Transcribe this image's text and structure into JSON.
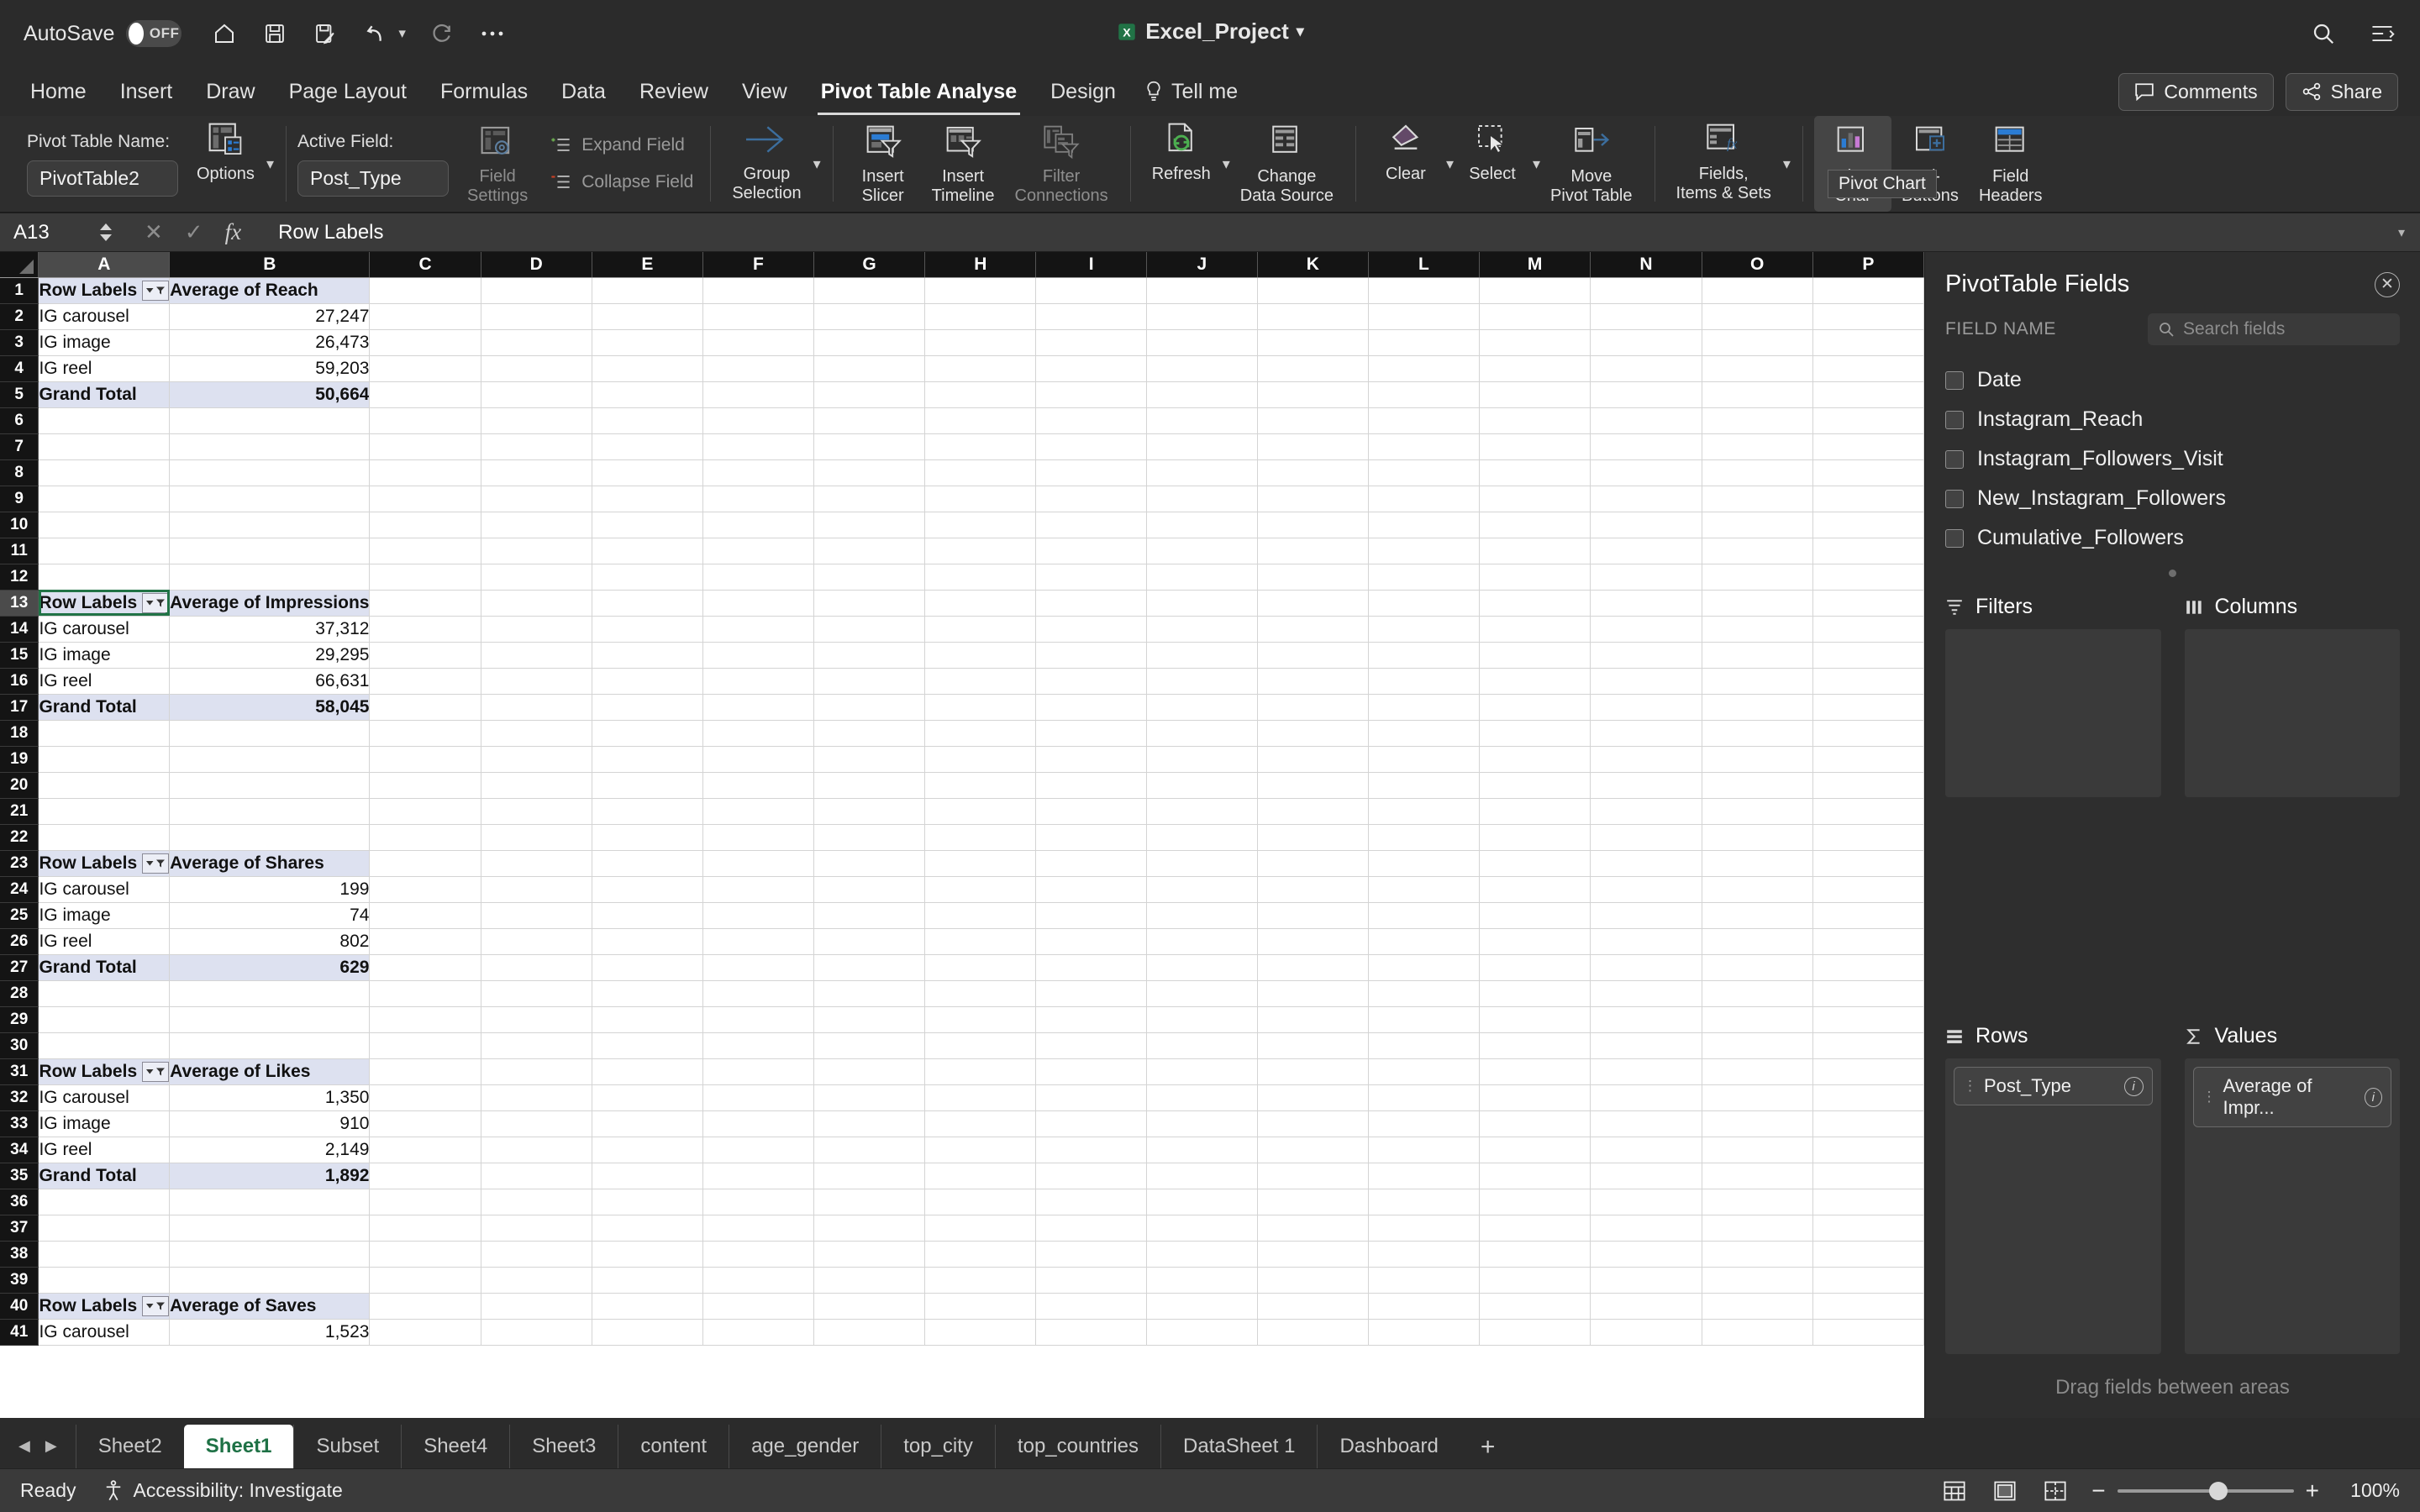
{
  "titlebar": {
    "autosave_label": "AutoSave",
    "autosave_state": "OFF",
    "doc_title": "Excel_Project",
    "icons": [
      "home-icon",
      "save-icon",
      "save-as-icon",
      "undo-icon",
      "redo-icon",
      "more-icon"
    ],
    "right_icons": [
      "search-icon",
      "ribbon-display-icon"
    ]
  },
  "ribbon_tabs": {
    "tabs": [
      {
        "label": "Home",
        "active": false
      },
      {
        "label": "Insert",
        "active": false
      },
      {
        "label": "Draw",
        "active": false
      },
      {
        "label": "Page Layout",
        "active": false
      },
      {
        "label": "Formulas",
        "active": false
      },
      {
        "label": "Data",
        "active": false
      },
      {
        "label": "Review",
        "active": false
      },
      {
        "label": "View",
        "active": false
      },
      {
        "label": "Pivot Table Analyse",
        "active": true
      },
      {
        "label": "Design",
        "active": false
      }
    ],
    "tell_me": "Tell me",
    "comments": "Comments",
    "share": "Share"
  },
  "ribbon": {
    "pivot_table_name_label": "Pivot Table Name:",
    "pivot_table_name_value": "PivotTable2",
    "options_label": "Options",
    "active_field_label": "Active Field:",
    "active_field_value": "Post_Type",
    "field_settings_label": "Field\nSettings",
    "expand_field_label": "Expand Field",
    "collapse_field_label": "Collapse Field",
    "group_selection_label": "Group\nSelection",
    "insert_slicer_label": "Insert\nSlicer",
    "insert_timeline_label": "Insert\nTimeline",
    "filter_connections_label": "Filter\nConnections",
    "refresh_label": "Refresh",
    "change_data_source_label": "Change\nData Source",
    "clear_label": "Clear",
    "select_label": "Select",
    "move_pivot_table_label": "Move\nPivot Table",
    "fields_items_sets_label": "Fields,\nItems & Sets",
    "pivot_chart_tooltip_partial": "Pivo\nChar",
    "pivot_chart_tooltip": "Pivot Chart",
    "plusminus_buttons_label": "+/-\nButtons",
    "field_headers_label": "Field\nHeaders"
  },
  "formula_bar": {
    "cell_ref": "A13",
    "formula": "Row Labels",
    "cancel_icon": "close-icon",
    "enter_icon": "check-icon",
    "fx_icon": "fx-icon"
  },
  "grid": {
    "columns": [
      "A",
      "B",
      "C",
      "D",
      "E",
      "F",
      "G",
      "H",
      "I",
      "J",
      "K",
      "L",
      "M",
      "N",
      "O",
      "P"
    ],
    "selected_column": "A",
    "selected_row": 13,
    "rows": [
      {
        "n": 1,
        "a": "Row Labels",
        "b": "Average of Reach",
        "style": "header",
        "filter": true
      },
      {
        "n": 2,
        "a": "IG carousel",
        "b": "27,247",
        "style": "data"
      },
      {
        "n": 3,
        "a": "IG image",
        "b": "26,473",
        "style": "data"
      },
      {
        "n": 4,
        "a": "IG reel",
        "b": "59,203",
        "style": "data"
      },
      {
        "n": 5,
        "a": "Grand Total",
        "b": "50,664",
        "style": "total"
      },
      {
        "n": 6,
        "a": "",
        "b": "",
        "style": "empty"
      },
      {
        "n": 7,
        "a": "",
        "b": "",
        "style": "empty"
      },
      {
        "n": 8,
        "a": "",
        "b": "",
        "style": "empty"
      },
      {
        "n": 9,
        "a": "",
        "b": "",
        "style": "empty"
      },
      {
        "n": 10,
        "a": "",
        "b": "",
        "style": "empty"
      },
      {
        "n": 11,
        "a": "",
        "b": "",
        "style": "empty"
      },
      {
        "n": 12,
        "a": "",
        "b": "",
        "style": "empty"
      },
      {
        "n": 13,
        "a": "Row Labels",
        "b": "Average of Impressions",
        "style": "header",
        "filter": true,
        "selected": true
      },
      {
        "n": 14,
        "a": "IG carousel",
        "b": "37,312",
        "style": "data"
      },
      {
        "n": 15,
        "a": "IG image",
        "b": "29,295",
        "style": "data"
      },
      {
        "n": 16,
        "a": "IG reel",
        "b": "66,631",
        "style": "data"
      },
      {
        "n": 17,
        "a": "Grand Total",
        "b": "58,045",
        "style": "total"
      },
      {
        "n": 18,
        "a": "",
        "b": "",
        "style": "empty"
      },
      {
        "n": 19,
        "a": "",
        "b": "",
        "style": "empty"
      },
      {
        "n": 20,
        "a": "",
        "b": "",
        "style": "empty"
      },
      {
        "n": 21,
        "a": "",
        "b": "",
        "style": "empty"
      },
      {
        "n": 22,
        "a": "",
        "b": "",
        "style": "empty"
      },
      {
        "n": 23,
        "a": "Row Labels",
        "b": "Average of Shares",
        "style": "header",
        "filter": true
      },
      {
        "n": 24,
        "a": "IG carousel",
        "b": "199",
        "style": "data"
      },
      {
        "n": 25,
        "a": "IG image",
        "b": "74",
        "style": "data"
      },
      {
        "n": 26,
        "a": "IG reel",
        "b": "802",
        "style": "data"
      },
      {
        "n": 27,
        "a": "Grand Total",
        "b": "629",
        "style": "total"
      },
      {
        "n": 28,
        "a": "",
        "b": "",
        "style": "empty"
      },
      {
        "n": 29,
        "a": "",
        "b": "",
        "style": "empty"
      },
      {
        "n": 30,
        "a": "",
        "b": "",
        "style": "empty"
      },
      {
        "n": 31,
        "a": "Row Labels",
        "b": "Average of Likes",
        "style": "header",
        "filter": true
      },
      {
        "n": 32,
        "a": "IG carousel",
        "b": "1,350",
        "style": "data"
      },
      {
        "n": 33,
        "a": "IG image",
        "b": "910",
        "style": "data"
      },
      {
        "n": 34,
        "a": "IG reel",
        "b": "2,149",
        "style": "data"
      },
      {
        "n": 35,
        "a": "Grand Total",
        "b": "1,892",
        "style": "total"
      },
      {
        "n": 36,
        "a": "",
        "b": "",
        "style": "empty"
      },
      {
        "n": 37,
        "a": "",
        "b": "",
        "style": "empty"
      },
      {
        "n": 38,
        "a": "",
        "b": "",
        "style": "empty"
      },
      {
        "n": 39,
        "a": "",
        "b": "",
        "style": "empty"
      },
      {
        "n": 40,
        "a": "Row Labels",
        "b": "Average of Saves",
        "style": "header",
        "filter": true
      },
      {
        "n": 41,
        "a": "IG carousel",
        "b": "1,523",
        "style": "data"
      }
    ]
  },
  "fields_pane": {
    "title": "PivotTable Fields",
    "field_name_label": "FIELD NAME",
    "search_placeholder": "Search fields",
    "fields": [
      {
        "label": "Date",
        "checked": false
      },
      {
        "label": "Instagram_Reach",
        "checked": false
      },
      {
        "label": "Instagram_Followers_Visit",
        "checked": false
      },
      {
        "label": "New_Instagram_Followers",
        "checked": false
      },
      {
        "label": "Cumulative_Followers",
        "checked": false
      }
    ],
    "areas": {
      "filters": {
        "label": "Filters",
        "items": []
      },
      "columns": {
        "label": "Columns",
        "items": []
      },
      "rows": {
        "label": "Rows",
        "items": [
          {
            "label": "Post_Type"
          }
        ]
      },
      "values": {
        "label": "Values",
        "items": [
          {
            "label": "Average of Impr..."
          }
        ]
      }
    },
    "drag_hint": "Drag fields between areas"
  },
  "sheet_tabs": {
    "tabs": [
      {
        "label": "Sheet2",
        "active": false
      },
      {
        "label": "Sheet1",
        "active": true
      },
      {
        "label": "Subset",
        "active": false
      },
      {
        "label": "Sheet4",
        "active": false
      },
      {
        "label": "Sheet3",
        "active": false
      },
      {
        "label": "content",
        "active": false
      },
      {
        "label": "age_gender",
        "active": false
      },
      {
        "label": "top_city",
        "active": false
      },
      {
        "label": "top_countries",
        "active": false
      },
      {
        "label": "DataSheet 1",
        "active": false
      },
      {
        "label": "Dashboard",
        "active": false
      }
    ],
    "add_label": "+"
  },
  "status_bar": {
    "ready": "Ready",
    "accessibility": "Accessibility: Investigate",
    "zoom": "100%",
    "views": [
      "normal-view-icon",
      "page-layout-view-icon",
      "page-break-view-icon"
    ]
  },
  "colors": {
    "accent_green": "#217346",
    "pivot_band": "#dde1f0",
    "ribbon_bg": "#2e2e2e",
    "title_bg": "#2b2b2b"
  }
}
